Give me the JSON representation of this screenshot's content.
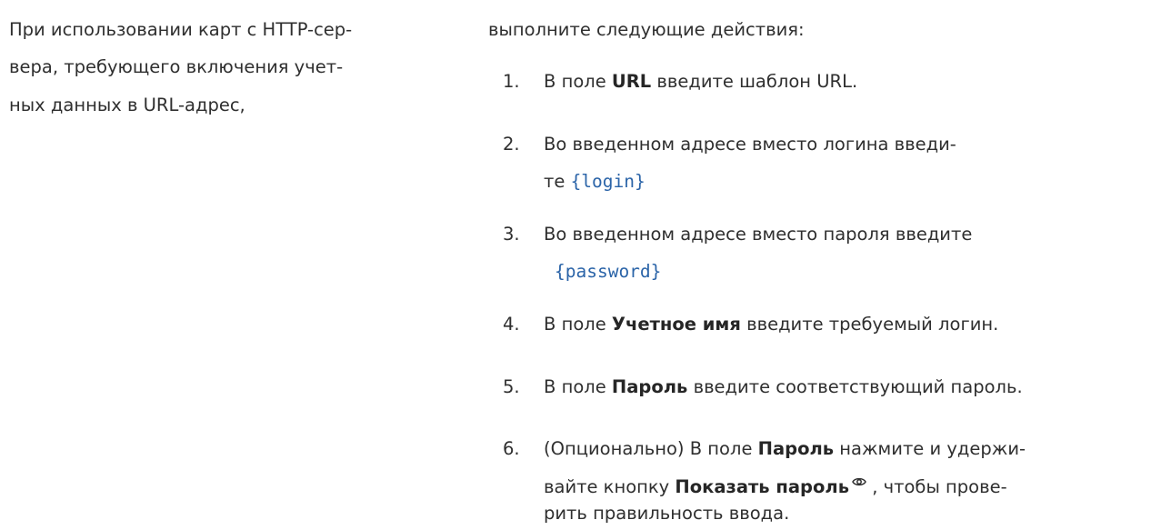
{
  "left_column": {
    "lines": [
      "При использовании карт с HTTP-сер-",
      "вера, требующего включения учет-",
      "ных данных в URL-адрес,"
    ]
  },
  "right_column": {
    "intro": "выполните следующие действия:",
    "steps": [
      {
        "number": "1.",
        "before": "В поле ",
        "bold": "URL",
        "after": " введите шаблон URL."
      },
      {
        "number": "2.",
        "line1": "Во введенном адресе вместо логина введи-",
        "line2_prefix": "те",
        "code": "{login}"
      },
      {
        "number": "3.",
        "line1": "Во введенном адресе вместо пароля введите",
        "code": "{password}"
      },
      {
        "number": "4.",
        "before": "В поле ",
        "bold": "Учетное имя",
        "after": " введите требуемый логин."
      },
      {
        "number": "5.",
        "before": "В поле ",
        "bold": "Пароль",
        "after": " введите соответствующий пароль."
      },
      {
        "number": "6.",
        "line1_before": "(Опционально) В поле ",
        "line1_bold": "Пароль",
        "line1_after": " нажмите и удержи-",
        "line2_before": "вайте кнопку ",
        "line2_bold": "Показать пароль",
        "line2_after": " , чтобы прове-",
        "line3": "рить правильность ввода.",
        "icon": "eye-icon"
      }
    ]
  }
}
